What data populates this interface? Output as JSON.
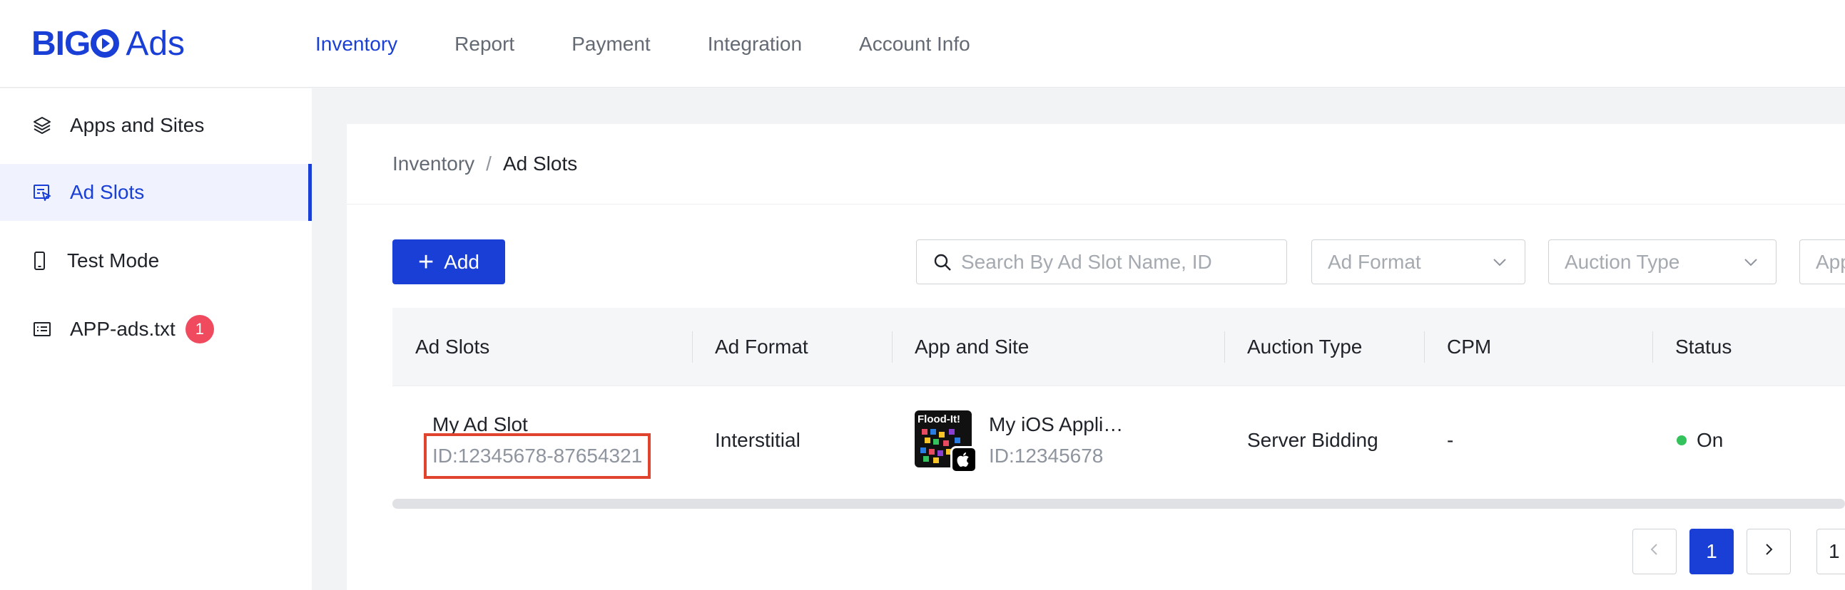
{
  "brand": {
    "logo_part1": "BIG",
    "logo_part2": "Ads"
  },
  "nav": [
    {
      "label": "Inventory",
      "active": true
    },
    {
      "label": "Report"
    },
    {
      "label": "Payment"
    },
    {
      "label": "Integration"
    },
    {
      "label": "Account Info"
    }
  ],
  "sidebar": {
    "items": [
      {
        "label": "Apps and Sites",
        "icon": "layers-icon"
      },
      {
        "label": "Ad Slots",
        "icon": "ad-slot-icon",
        "active": true
      },
      {
        "label": "Test Mode",
        "icon": "phone-icon"
      },
      {
        "label": "APP-ads.txt",
        "icon": "document-list-icon",
        "badge": "1"
      }
    ]
  },
  "breadcrumb": {
    "parent": "Inventory",
    "separator": "/",
    "current": "Ad Slots"
  },
  "toolbar": {
    "add_label": "Add",
    "search_placeholder": "Search By Ad Slot Name, ID",
    "filters": [
      "Ad Format",
      "Auction Type",
      "App"
    ]
  },
  "table": {
    "columns": [
      "Ad Slots",
      "Ad Format",
      "App and Site",
      "Auction Type",
      "CPM",
      "Status"
    ],
    "rows": [
      {
        "slot_name": "My Ad Slot",
        "slot_id": "ID:12345678-87654321",
        "ad_format": "Interstitial",
        "app_name": "My iOS Appli…",
        "app_id": "ID:12345678",
        "app_icon_text": "Flood-It!",
        "auction_type": "Server Bidding",
        "cpm": "-",
        "status": "On"
      }
    ]
  },
  "pagination": {
    "current": "1",
    "page_size_partial": "1"
  },
  "colors": {
    "accent": "#1a3fd6",
    "status_on": "#34c25c",
    "badge": "#f04a5f",
    "highlight": "#e0442f"
  }
}
